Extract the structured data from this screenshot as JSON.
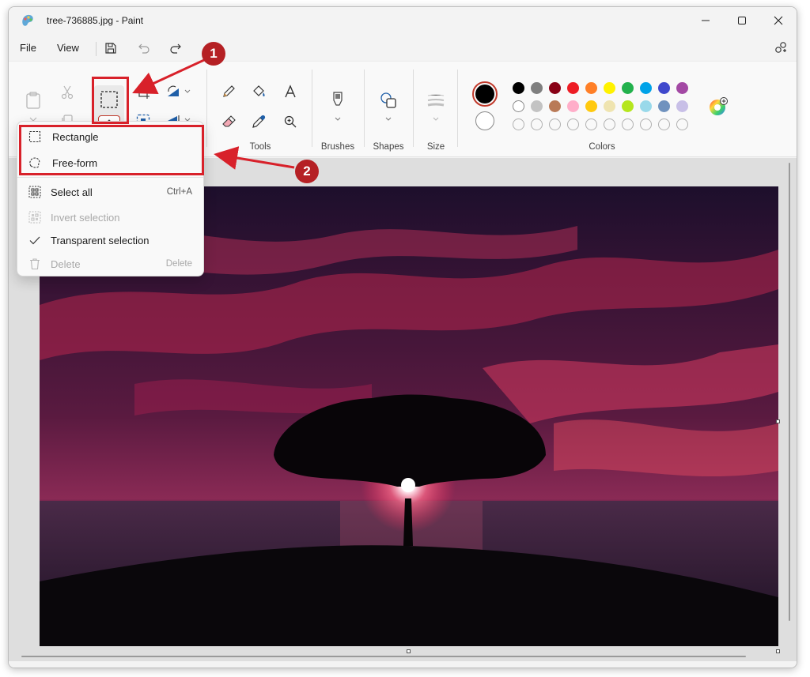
{
  "window": {
    "title": "tree-736885.jpg - Paint",
    "minimize_icon": "minimize-icon",
    "maximize_icon": "maximize-icon",
    "close_icon": "close-icon"
  },
  "menu": {
    "file": "File",
    "view": "View",
    "save_icon": "save-icon",
    "undo_icon": "undo-icon",
    "redo_icon": "redo-icon",
    "settings_icon": "settings-icon"
  },
  "ribbon": {
    "groups": {
      "tools": "Tools",
      "brushes": "Brushes",
      "shapes": "Shapes",
      "size": "Size",
      "colors": "Colors"
    }
  },
  "colors": {
    "primary": "#000000",
    "secondary": "#ffffff",
    "palette_row1": [
      "#000000",
      "#7f7f7f",
      "#880015",
      "#ed1c24",
      "#ff7f27",
      "#fff200",
      "#22b14c",
      "#00a2e8",
      "#3f48cc",
      "#a349a4"
    ],
    "palette_row2": [
      "#ffffff",
      "#c3c3c3",
      "#b97a57",
      "#ffaec9",
      "#ffc90e",
      "#efe4b0",
      "#b5e61d",
      "#99d9ea",
      "#7092be",
      "#c8bfe7"
    ],
    "palette_row3_count": 10
  },
  "dropdown": {
    "items": [
      {
        "label": "Rectangle",
        "shortcut": "",
        "icon": "rectangle-select-icon",
        "disabled": false
      },
      {
        "label": "Free-form",
        "shortcut": "",
        "icon": "freeform-select-icon",
        "disabled": false
      },
      {
        "label": "Select all",
        "shortcut": "Ctrl+A",
        "icon": "select-all-icon",
        "disabled": false
      },
      {
        "label": "Invert selection",
        "shortcut": "",
        "icon": "invert-selection-icon",
        "disabled": true
      },
      {
        "label": "Transparent selection",
        "shortcut": "",
        "icon": "check-icon",
        "disabled": false
      },
      {
        "label": "Delete",
        "shortcut": "Delete",
        "icon": "delete-icon",
        "disabled": true
      }
    ]
  },
  "annotations": {
    "badge1": "1",
    "badge2": "2",
    "highlight_color": "#d8212a"
  }
}
